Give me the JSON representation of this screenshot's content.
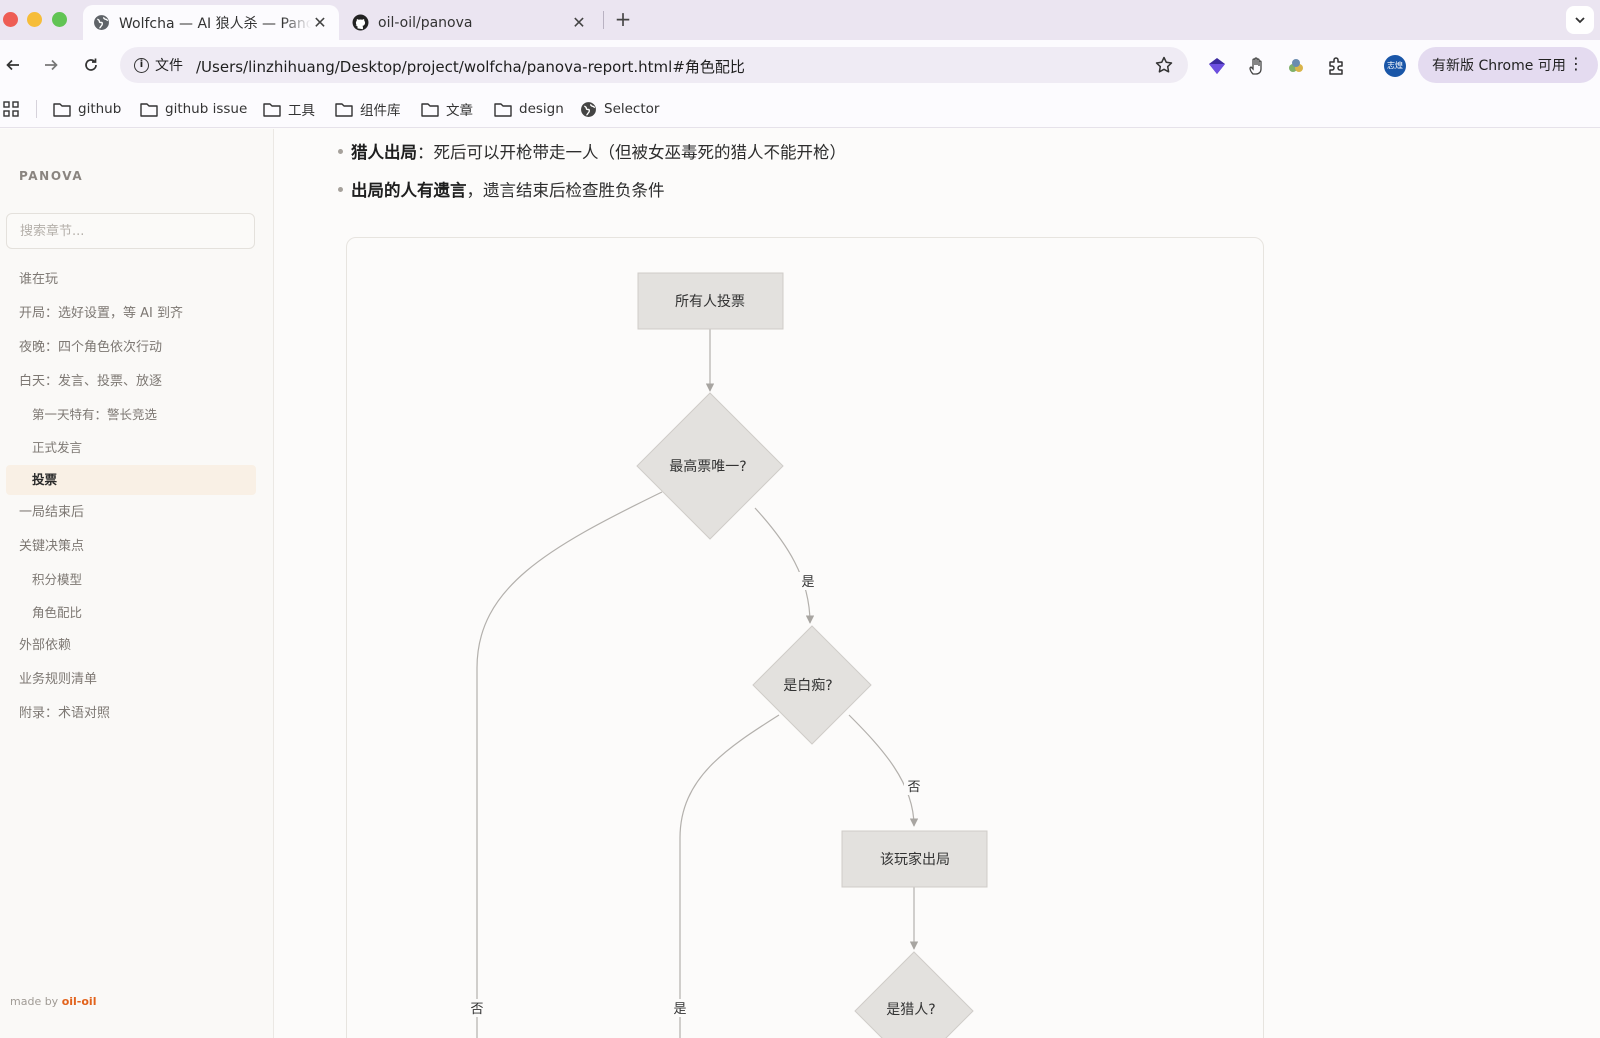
{
  "browser": {
    "tabs": [
      {
        "title": "Wolfcha — AI 狼人杀 — Panova",
        "active": true
      },
      {
        "title": "oil-oil/panova",
        "active": false
      }
    ],
    "address": {
      "security_label": "文件",
      "url": "/Users/linzhihuang/Desktop/project/wolfcha/panova-report.html#角色配比"
    },
    "avatar_text": "志煌",
    "update_label": "有新版 Chrome 可用",
    "bookmarks": [
      {
        "label": "github",
        "icon": "folder-icon"
      },
      {
        "label": "github issue",
        "icon": "folder-icon"
      },
      {
        "label": "工具",
        "icon": "folder-icon"
      },
      {
        "label": "组件库",
        "icon": "folder-icon"
      },
      {
        "label": "文章",
        "icon": "folder-icon"
      },
      {
        "label": "design",
        "icon": "folder-icon"
      },
      {
        "label": "Selector",
        "icon": "globe-icon"
      }
    ]
  },
  "sidebar": {
    "brand": "PANOVA",
    "search_placeholder": "搜索章节...",
    "items": [
      {
        "label": "谁在玩",
        "level": 1,
        "active": false
      },
      {
        "label": "开局：选好设置，等 AI 到齐",
        "level": 1,
        "active": false
      },
      {
        "label": "夜晚：四个角色依次行动",
        "level": 1,
        "active": false
      },
      {
        "label": "白天：发言、投票、放逐",
        "level": 1,
        "active": false
      },
      {
        "label": "第一天特有：警长竞选",
        "level": 2,
        "active": false
      },
      {
        "label": "正式发言",
        "level": 2,
        "active": false
      },
      {
        "label": "投票",
        "level": 2,
        "active": true
      },
      {
        "label": "一局结束后",
        "level": 1,
        "active": false
      },
      {
        "label": "关键决策点",
        "level": 1,
        "active": false
      },
      {
        "label": "积分模型",
        "level": 2,
        "active": false
      },
      {
        "label": "角色配比",
        "level": 2,
        "active": false
      },
      {
        "label": "外部依赖",
        "level": 1,
        "active": false
      },
      {
        "label": "业务规则清单",
        "level": 1,
        "active": false
      },
      {
        "label": "附录：术语对照",
        "level": 1,
        "active": false
      }
    ],
    "footer": {
      "prefix": "made by",
      "author": "oil-oil"
    }
  },
  "content": {
    "bullets": [
      {
        "bold": "猎人出局",
        "text": "：死后可以开枪带走一人（但被女巫毒死的猎人不能开枪）"
      },
      {
        "bold": "出局的人有遗言",
        "text": "，遗言结束后检查胜负条件"
      }
    ],
    "flowchart": {
      "nodes": [
        {
          "id": "vote",
          "shape": "rect",
          "label": "所有人投票"
        },
        {
          "id": "unique",
          "shape": "diamond",
          "label": "最高票唯一?"
        },
        {
          "id": "idiot",
          "shape": "diamond",
          "label": "是白痴?"
        },
        {
          "id": "out",
          "shape": "rect",
          "label": "该玩家出局"
        },
        {
          "id": "hunter",
          "shape": "diamond",
          "label": "是猎人?"
        }
      ],
      "edges": [
        {
          "from": "vote",
          "to": "unique",
          "label": ""
        },
        {
          "from": "unique",
          "to": "idiot",
          "label": "是"
        },
        {
          "from": "unique",
          "to": "",
          "label": "否"
        },
        {
          "from": "idiot",
          "to": "out",
          "label": "否"
        },
        {
          "from": "idiot",
          "to": "",
          "label": "是"
        },
        {
          "from": "out",
          "to": "hunter",
          "label": ""
        }
      ]
    }
  }
}
